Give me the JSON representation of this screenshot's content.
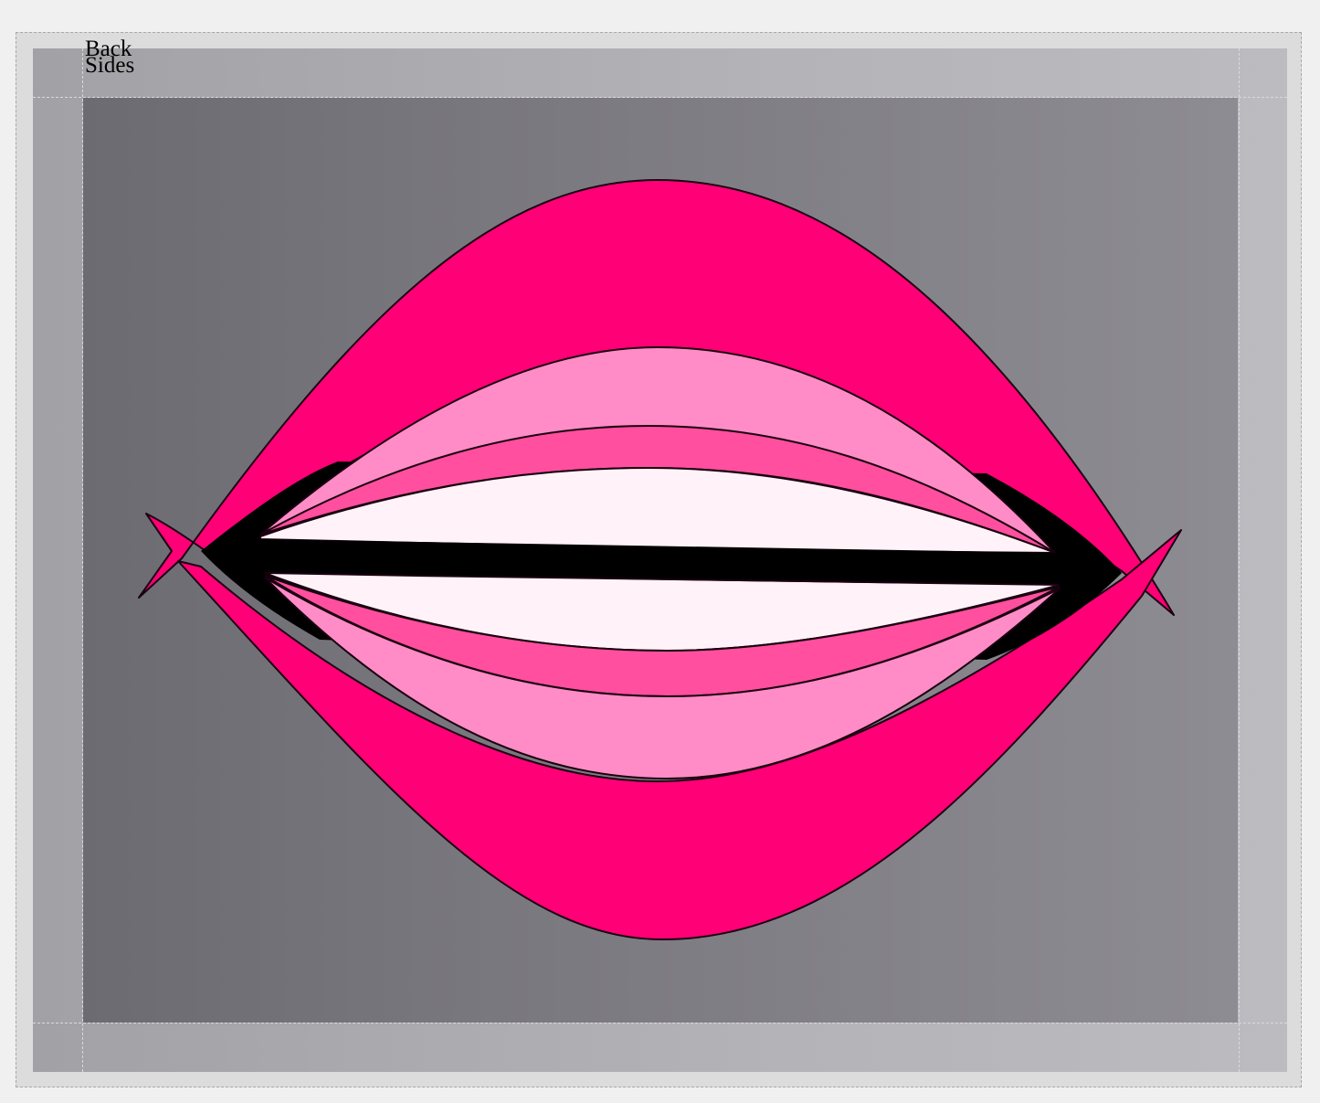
{
  "labels": {
    "back": "Back",
    "sides": "Sides"
  },
  "colors": {
    "outer_lip": "#ff0077",
    "inner_lip": "#ff8cc6",
    "middle_lip": "#ff4f9e",
    "teeth": "#fff2f8",
    "mouth_line": "#000000",
    "panel_dark": "#6c6b72",
    "panel_light": "#8d8c92",
    "band": "#b4b4b8",
    "frame": "#dcdcdc"
  }
}
